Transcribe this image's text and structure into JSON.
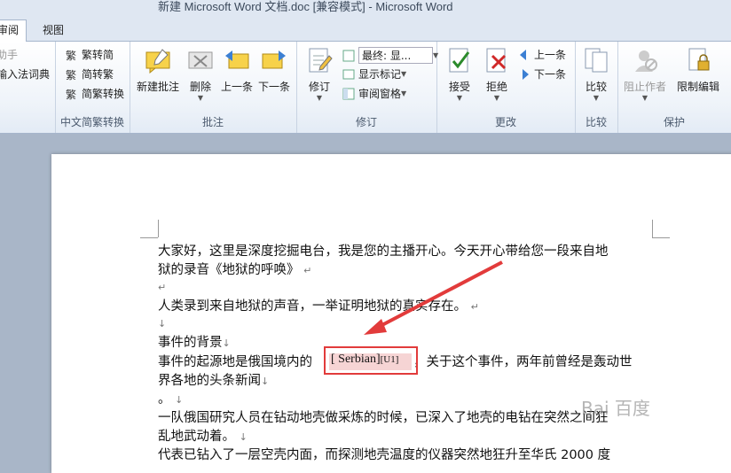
{
  "window": {
    "title": "新建 Microsoft Word 文档.doc [兼容模式] - Microsoft Word"
  },
  "tabs": [
    {
      "label": "审阅",
      "active": true
    },
    {
      "label": "视图",
      "active": false
    }
  ],
  "ribbon": {
    "cut_left_items": [
      "助手",
      "输入法词典"
    ],
    "chinese_conv": {
      "items": [
        "繁转简",
        "简转繁",
        "简繁转换"
      ],
      "label": "中文简繁转换"
    },
    "comments": {
      "new": "新建批注",
      "delete": "删除",
      "prev": "上一条",
      "next": "下一条",
      "label": "批注"
    },
    "tracking": {
      "track": "修订",
      "display_for_review": "最终: 显...",
      "show_markup": "显示标记",
      "reviewing_pane": "审阅窗格",
      "label": "修订"
    },
    "changes": {
      "accept": "接受",
      "reject": "拒绝",
      "prev": "上一条",
      "next": "下一条",
      "label": "更改"
    },
    "compare": {
      "compare": "比较",
      "label": "比较"
    },
    "protect": {
      "block_authors": "阻止作者",
      "restrict_editing": "限制编辑",
      "label": "保护"
    }
  },
  "document": {
    "lines": [
      "大家好，这里是深度挖掘电台，我是您的主播开心。今天开心带给您一段来自地",
      "狱的录音《地狱的呼唤》",
      "",
      "人类录到来自地狱的声音，一举证明地狱的真实存在。",
      "",
      "事件的背景",
      "事件的起源地是俄国境内的",
      "，关于这个事件，两年前曾经是轰动世",
      "界各地的头条新闻",
      "。",
      "一队俄国研究人员在钻动地壳做采炼的时候，已深入了地壳的电钻在突然之间狂",
      "乱地武动着。",
      "代表已钻入了一层空壳内面，而探测地壳温度的仪器突然地狂升至华氏 2000 度"
    ],
    "highlighted_word": "Serbian",
    "comment_marker": "U1",
    "watermark": "Bai 百度"
  },
  "colors": {
    "accent": "#e23b3b",
    "ribbon_bg": "#eef3f9",
    "highlight_fill": "#f6d4d4"
  }
}
